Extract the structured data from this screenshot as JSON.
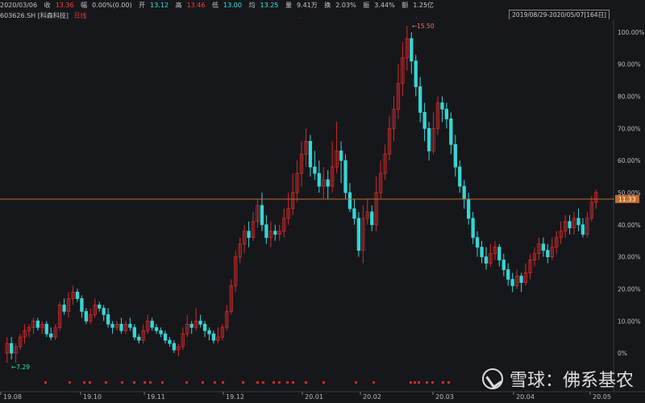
{
  "info_bar": {
    "date": "2020/03/06",
    "close_label": "收",
    "close_value": "13.36",
    "change_label": "幅",
    "change_value": "0.00%(0.00)",
    "open_label": "开",
    "open_value": "13.12",
    "high_label": "高",
    "high_value": "13.46",
    "low_label": "低",
    "low_value": "13.00",
    "avg_label": "均",
    "avg_value": "13.25",
    "volume_label": "量",
    "volume_value": "9.41万",
    "turnover_label": "换",
    "turnover_value": "2.03%",
    "amplitude_label": "振",
    "amplitude_value": "3.44%",
    "amount_label": "额",
    "amount_value": "1.25亿"
  },
  "symbol": "603626.SH",
  "name": "[科森科技]",
  "indicator": "日线",
  "range_label": "2019/08/29-2020/05/07[164日]",
  "watermark": "雪球：佛系基农",
  "colors": {
    "up": "#d42a2a",
    "down": "#36d6d6",
    "background": "#16171b",
    "price_line": "#c46a2a",
    "grid": "#2a2b30",
    "markers": "#d42a2a"
  },
  "chart_data": {
    "type": "candlestick",
    "x_tick_labels": [
      "19.08",
      "19.10",
      "19.11",
      "19.12",
      "20.01",
      "20.02",
      "20.03",
      "20.04",
      "20.05"
    ],
    "y_tick_labels": [
      "100.00%",
      "90.00%",
      "80.00%",
      "70.00%",
      "60.00%",
      "50.00%",
      "40.00%",
      "30.00%",
      "20.00%",
      "10.00%",
      "0%"
    ],
    "ylim_pct": [
      -5,
      104
    ],
    "base_price": 7.29,
    "low_annotation": "7.29",
    "high_annotation": "15.50",
    "current_price_label": "11.33",
    "current_price_pct": 48,
    "candles": [
      [
        0,
        3,
        5,
        -3
      ],
      [
        3,
        0,
        5,
        -2
      ],
      [
        0,
        2,
        3,
        -3
      ],
      [
        2,
        5,
        6,
        1
      ],
      [
        5,
        7,
        9,
        3
      ],
      [
        7,
        8,
        9,
        5
      ],
      [
        8,
        10,
        11,
        6
      ],
      [
        10,
        8,
        11,
        7
      ],
      [
        8,
        9,
        10,
        6
      ],
      [
        9,
        6,
        10,
        5
      ],
      [
        6,
        5,
        8,
        4
      ],
      [
        5,
        8,
        9,
        4
      ],
      [
        8,
        15,
        16,
        7
      ],
      [
        15,
        13,
        17,
        12
      ],
      [
        13,
        17,
        19,
        11
      ],
      [
        17,
        19,
        21,
        15
      ],
      [
        19,
        17,
        20,
        16
      ],
      [
        17,
        13,
        18,
        11
      ],
      [
        13,
        10,
        14,
        9
      ],
      [
        10,
        12,
        14,
        9
      ],
      [
        12,
        15,
        17,
        11
      ],
      [
        15,
        14,
        16,
        13
      ],
      [
        14,
        12,
        15,
        10
      ],
      [
        12,
        9,
        14,
        8
      ],
      [
        9,
        8,
        10,
        6
      ],
      [
        8,
        9,
        10,
        7
      ],
      [
        9,
        7,
        11,
        6
      ],
      [
        7,
        9,
        10,
        6
      ],
      [
        9,
        8,
        11,
        7
      ],
      [
        8,
        5,
        9,
        4
      ],
      [
        5,
        4,
        6,
        3
      ],
      [
        4,
        7,
        9,
        3
      ],
      [
        7,
        10,
        12,
        6
      ],
      [
        10,
        8,
        11,
        7
      ],
      [
        8,
        7,
        9,
        6
      ],
      [
        7,
        6,
        8,
        5
      ],
      [
        6,
        4,
        7,
        3
      ],
      [
        4,
        3,
        5,
        2
      ],
      [
        3,
        1,
        4,
        0
      ],
      [
        1,
        2,
        3,
        -1
      ],
      [
        2,
        6,
        8,
        1
      ],
      [
        6,
        9,
        12,
        5
      ],
      [
        9,
        8,
        10,
        6
      ],
      [
        8,
        10,
        14,
        7
      ],
      [
        10,
        9,
        12,
        8
      ],
      [
        9,
        7,
        10,
        5
      ],
      [
        7,
        6,
        8,
        4
      ],
      [
        6,
        4,
        7,
        3
      ],
      [
        4,
        5,
        8,
        3
      ],
      [
        5,
        8,
        9,
        4
      ],
      [
        8,
        13,
        15,
        7
      ],
      [
        13,
        21,
        23,
        12
      ],
      [
        21,
        30,
        32,
        19
      ],
      [
        30,
        34,
        36,
        28
      ],
      [
        34,
        38,
        40,
        31
      ],
      [
        38,
        36,
        41,
        33
      ],
      [
        36,
        41,
        44,
        35
      ],
      [
        41,
        46,
        48,
        39
      ],
      [
        46,
        40,
        50,
        38
      ],
      [
        40,
        36,
        43,
        34
      ],
      [
        36,
        38,
        41,
        33
      ],
      [
        38,
        37,
        40,
        35
      ],
      [
        37,
        38,
        40,
        35
      ],
      [
        38,
        42,
        45,
        36
      ],
      [
        42,
        45,
        50,
        40
      ],
      [
        45,
        50,
        56,
        43
      ],
      [
        50,
        56,
        60,
        47
      ],
      [
        56,
        62,
        66,
        52
      ],
      [
        62,
        66,
        70,
        58
      ],
      [
        66,
        58,
        68,
        55
      ],
      [
        58,
        56,
        63,
        54
      ],
      [
        56,
        52,
        60,
        50
      ],
      [
        52,
        54,
        58,
        48
      ],
      [
        54,
        52,
        57,
        48
      ],
      [
        52,
        58,
        66,
        50
      ],
      [
        58,
        63,
        72,
        56
      ],
      [
        63,
        60,
        66,
        53
      ],
      [
        60,
        50,
        62,
        48
      ],
      [
        50,
        45,
        53,
        44
      ],
      [
        45,
        42,
        48,
        40
      ],
      [
        42,
        32,
        44,
        30
      ],
      [
        32,
        42,
        46,
        28
      ],
      [
        42,
        44,
        48,
        40
      ],
      [
        44,
        40,
        46,
        38
      ],
      [
        40,
        50,
        55,
        38
      ],
      [
        50,
        56,
        60,
        48
      ],
      [
        56,
        62,
        65,
        54
      ],
      [
        62,
        70,
        74,
        60
      ],
      [
        70,
        76,
        80,
        66
      ],
      [
        76,
        84,
        90,
        73
      ],
      [
        84,
        92,
        97,
        80
      ],
      [
        92,
        98,
        102,
        88
      ],
      [
        98,
        91,
        100,
        87
      ],
      [
        91,
        83,
        93,
        80
      ],
      [
        83,
        75,
        86,
        72
      ],
      [
        75,
        70,
        78,
        66
      ],
      [
        70,
        63,
        72,
        60
      ],
      [
        63,
        70,
        75,
        62
      ],
      [
        70,
        78,
        80,
        68
      ],
      [
        78,
        76,
        80,
        72
      ],
      [
        76,
        73,
        78,
        70
      ],
      [
        73,
        65,
        75,
        62
      ],
      [
        65,
        58,
        68,
        55
      ],
      [
        58,
        52,
        60,
        50
      ],
      [
        52,
        48,
        54,
        45
      ],
      [
        48,
        42,
        50,
        40
      ],
      [
        42,
        36,
        44,
        34
      ],
      [
        36,
        33,
        38,
        30
      ],
      [
        33,
        30,
        35,
        28
      ],
      [
        30,
        28,
        33,
        26
      ],
      [
        28,
        31,
        34,
        27
      ],
      [
        31,
        33,
        35,
        29
      ],
      [
        33,
        29,
        34,
        27
      ],
      [
        29,
        26,
        31,
        24
      ],
      [
        26,
        23,
        28,
        21
      ],
      [
        23,
        21,
        25,
        19
      ],
      [
        21,
        24,
        26,
        20
      ],
      [
        24,
        22,
        25,
        19
      ],
      [
        22,
        25,
        28,
        21
      ],
      [
        25,
        29,
        31,
        23
      ],
      [
        29,
        31,
        33,
        27
      ],
      [
        31,
        34,
        36,
        29
      ],
      [
        34,
        32,
        36,
        30
      ],
      [
        32,
        30,
        34,
        28
      ],
      [
        30,
        33,
        36,
        29
      ],
      [
        33,
        36,
        38,
        31
      ],
      [
        36,
        38,
        41,
        34
      ],
      [
        38,
        41,
        43,
        36
      ],
      [
        41,
        39,
        43,
        37
      ],
      [
        39,
        42,
        44,
        37
      ],
      [
        42,
        40,
        45,
        38
      ],
      [
        40,
        37,
        42,
        36
      ],
      [
        37,
        42,
        44,
        36
      ],
      [
        42,
        47,
        49,
        41
      ],
      [
        47,
        50,
        51,
        45
      ]
    ]
  }
}
